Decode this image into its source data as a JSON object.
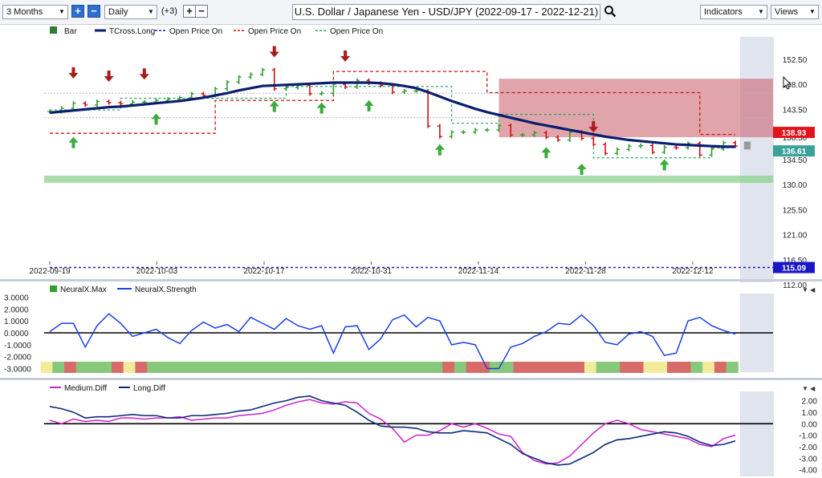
{
  "toolbar": {
    "range_label": "3 Months",
    "interval_label": "Daily",
    "indicator_count": "(+3)",
    "title": "U.S. Dollar / Japanese Yen - USD/JPY (2022-09-17 - 2022-12-21)",
    "indicators_label": "Indicators",
    "views_label": "Views",
    "plus": "+",
    "minus": "−"
  },
  "icons": [
    "dropdown-arrow-icon",
    "zoom-in-icon",
    "zoom-out-icon",
    "search-icon",
    "mouse-cursor-icon",
    "collapse-arrow-icon"
  ],
  "colors": {
    "bull": "#2e9e2e",
    "bear": "#cc1111",
    "tcross": "#0b1e6e",
    "neural": "#1a3fe0",
    "medium": "#cc22cc",
    "long": "#0c2a7a",
    "band_green": "#8fd18f",
    "band_red": "#c95a64"
  },
  "chart_data": [
    {
      "type": "candlestick",
      "title": "U.S. Dollar / Japanese Yen - USD/JPY (2022-09-17 - 2022-12-21)",
      "legend": [
        {
          "name": "Bar"
        },
        {
          "name": "TCross.Long"
        },
        {
          "name": "Open Price On"
        },
        {
          "name": "Open Price On"
        },
        {
          "name": "Open Price On"
        }
      ],
      "y_ticks": [
        "152.50",
        "148.00",
        "143.50",
        "138.50",
        "134.50",
        "130.00",
        "125.50",
        "121.00",
        "116.50",
        "112.00"
      ],
      "ylim": [
        112,
        154.5
      ],
      "x_ticks": [
        "2022-09-19",
        "2022-10-03",
        "2022-10-17",
        "2022-10-31",
        "2022-11-14",
        "2022-11-28",
        "2022-12-12"
      ],
      "price_labels": [
        "138.93",
        "136.61",
        "115.09"
      ],
      "close": [
        143.1,
        143.7,
        144.6,
        144.3,
        144.9,
        144.7,
        144.5,
        144.8,
        144.8,
        145.1,
        145.3,
        145.6,
        146.3,
        146.0,
        147.2,
        148.4,
        149.3,
        149.8,
        150.6,
        147.2,
        147.4,
        147.8,
        146.3,
        146.4,
        148.0,
        147.5,
        148.7,
        148.2,
        147.8,
        146.6,
        146.8,
        146.8,
        140.5,
        138.6,
        139.4,
        139.4,
        139.8,
        139.8,
        140.6,
        138.9,
        138.9,
        139.3,
        138.5,
        138.0,
        139.4,
        138.3,
        137.2,
        135.6,
        136.3,
        136.9,
        137.0,
        135.8,
        136.7,
        136.6,
        137.4,
        135.3,
        136.4,
        137.5,
        136.9
      ],
      "tcross_long": [
        142.9,
        143.1,
        143.3,
        143.5,
        143.7,
        143.9,
        144.0,
        144.2,
        144.4,
        144.6,
        144.8,
        145.0,
        145.3,
        145.6,
        146.0,
        146.4,
        146.9,
        147.3,
        147.7,
        147.8,
        147.9,
        148.0,
        148.1,
        148.2,
        148.3,
        148.3,
        148.3,
        148.3,
        148.2,
        148.0,
        147.7,
        147.3,
        146.6,
        145.8,
        145.0,
        144.3,
        143.6,
        143.0,
        142.5,
        142.0,
        141.5,
        141.0,
        140.6,
        140.2,
        139.8,
        139.4,
        139.0,
        138.6,
        138.3,
        138.0,
        137.8,
        137.6,
        137.4,
        137.2,
        137.1,
        137.0,
        136.9,
        136.8,
        136.8
      ],
      "green_band": [
        130.3,
        131.6
      ],
      "red_band": [
        138.5,
        149.0
      ],
      "blue_line": 115.09
    },
    {
      "type": "line",
      "legend": [
        {
          "name": "NeuralX.Max"
        },
        {
          "name": "NeuralX.Strength"
        }
      ],
      "y_ticks": [
        "3.0000",
        "2.0000",
        "1.0000",
        "0.0000",
        "-1.0000",
        "-2.0000",
        "-3.0000"
      ],
      "ylim": [
        -3.3,
        3.3
      ],
      "series": [
        {
          "name": "NeuralX.Strength",
          "values": [
            0.1,
            0.8,
            0.8,
            -1.2,
            0.6,
            1.6,
            0.8,
            -0.3,
            0.0,
            0.3,
            -0.4,
            -0.9,
            0.2,
            0.9,
            0.4,
            0.7,
            0.1,
            1.3,
            0.8,
            0.3,
            1.2,
            0.6,
            0.3,
            0.6,
            -1.7,
            0.5,
            0.6,
            -1.4,
            -0.5,
            1.1,
            1.5,
            0.5,
            1.3,
            1.0,
            -1.0,
            -0.8,
            -1.0,
            -3.0,
            -3.0,
            -1.2,
            -0.9,
            -0.3,
            0.1,
            0.8,
            0.7,
            1.5,
            0.6,
            -0.8,
            -1.0,
            -0.1,
            0.1,
            -0.3,
            -1.9,
            -1.7,
            1.0,
            1.3,
            0.6,
            0.2,
            -0.1
          ]
        }
      ],
      "signal_colors": [
        "yellow",
        "green",
        "red",
        "green",
        "green",
        "green",
        "red",
        "yellow",
        "red",
        "green",
        "green",
        "green",
        "green",
        "green",
        "green",
        "green",
        "green",
        "green",
        "green",
        "green",
        "green",
        "green",
        "green",
        "green",
        "green",
        "green",
        "green",
        "green",
        "green",
        "green",
        "green",
        "green",
        "green",
        "green",
        "red",
        "green",
        "red",
        "red",
        "green",
        "green",
        "red",
        "red",
        "red",
        "red",
        "red",
        "red",
        "yellow",
        "green",
        "green",
        "red",
        "red",
        "yellow",
        "yellow",
        "red",
        "red",
        "green",
        "yellow",
        "red",
        "green"
      ]
    },
    {
      "type": "line",
      "legend": [
        {
          "name": "Medium.Diff"
        },
        {
          "name": "Long.Diff"
        }
      ],
      "y_ticks": [
        "2.00",
        "1.00",
        "0.00",
        "-1.00",
        "-2.00",
        "-3.00",
        "-4.00"
      ],
      "ylim": [
        -4.3,
        2.6
      ],
      "series": [
        {
          "name": "Medium.Diff",
          "values": [
            0.3,
            0.0,
            0.4,
            0.2,
            0.3,
            0.2,
            0.5,
            0.5,
            0.4,
            0.5,
            0.5,
            0.6,
            0.3,
            0.4,
            0.5,
            0.5,
            0.7,
            0.8,
            0.9,
            1.2,
            1.6,
            1.9,
            2.1,
            1.8,
            1.7,
            1.9,
            1.8,
            0.9,
            0.4,
            -0.4,
            -1.6,
            -1.0,
            -1.0,
            -0.6,
            0.0,
            -0.3,
            0.0,
            -0.4,
            -0.9,
            -1.1,
            -2.5,
            -3.2,
            -3.5,
            -3.4,
            -2.8,
            -1.8,
            -0.8,
            0.0,
            0.3,
            0.0,
            -0.5,
            -0.7,
            -0.9,
            -1.1,
            -1.3,
            -1.8,
            -2.0,
            -1.3,
            -1.0
          ]
        },
        {
          "name": "Long.Diff",
          "values": [
            1.5,
            1.3,
            1.0,
            0.5,
            0.6,
            0.6,
            0.7,
            0.8,
            0.7,
            0.7,
            0.5,
            0.5,
            0.7,
            0.7,
            0.8,
            0.9,
            1.1,
            1.2,
            1.5,
            1.8,
            2.0,
            2.3,
            2.4,
            2.0,
            1.8,
            1.6,
            1.0,
            0.3,
            -0.2,
            -0.3,
            -0.3,
            -0.4,
            -0.7,
            -0.8,
            -0.8,
            -0.6,
            -0.7,
            -0.8,
            -1.3,
            -1.8,
            -2.6,
            -3.0,
            -3.4,
            -3.6,
            -3.5,
            -3.0,
            -2.5,
            -1.8,
            -1.4,
            -1.3,
            -1.1,
            -0.9,
            -0.7,
            -0.8,
            -1.1,
            -1.6,
            -1.9,
            -1.8,
            -1.5
          ]
        }
      ]
    }
  ]
}
